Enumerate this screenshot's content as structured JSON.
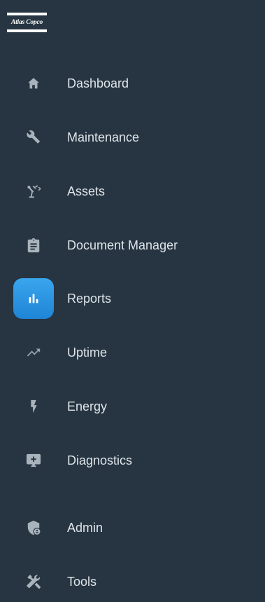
{
  "brand": {
    "logo_text": "Atlas Copco"
  },
  "nav": {
    "items": [
      {
        "label": "Dashboard",
        "icon": "home-icon"
      },
      {
        "label": "Maintenance",
        "icon": "wrench-icon"
      },
      {
        "label": "Assets",
        "icon": "robot-arm-icon"
      },
      {
        "label": "Document Manager",
        "icon": "clipboard-icon"
      },
      {
        "label": "Reports",
        "icon": "bar-chart-icon",
        "active": true
      },
      {
        "label": "Uptime",
        "icon": "trending-up-icon"
      },
      {
        "label": "Energy",
        "icon": "lightning-icon"
      },
      {
        "label": "Diagnostics",
        "icon": "monitor-plus-icon"
      },
      {
        "label": "Admin",
        "icon": "shield-user-icon"
      },
      {
        "label": "Tools",
        "icon": "tools-icon"
      }
    ]
  },
  "colors": {
    "sidebar_bg": "#263541",
    "icon_default": "#a9b3bb",
    "text": "#dfe5ea",
    "active_accent": "#2a95e3"
  }
}
